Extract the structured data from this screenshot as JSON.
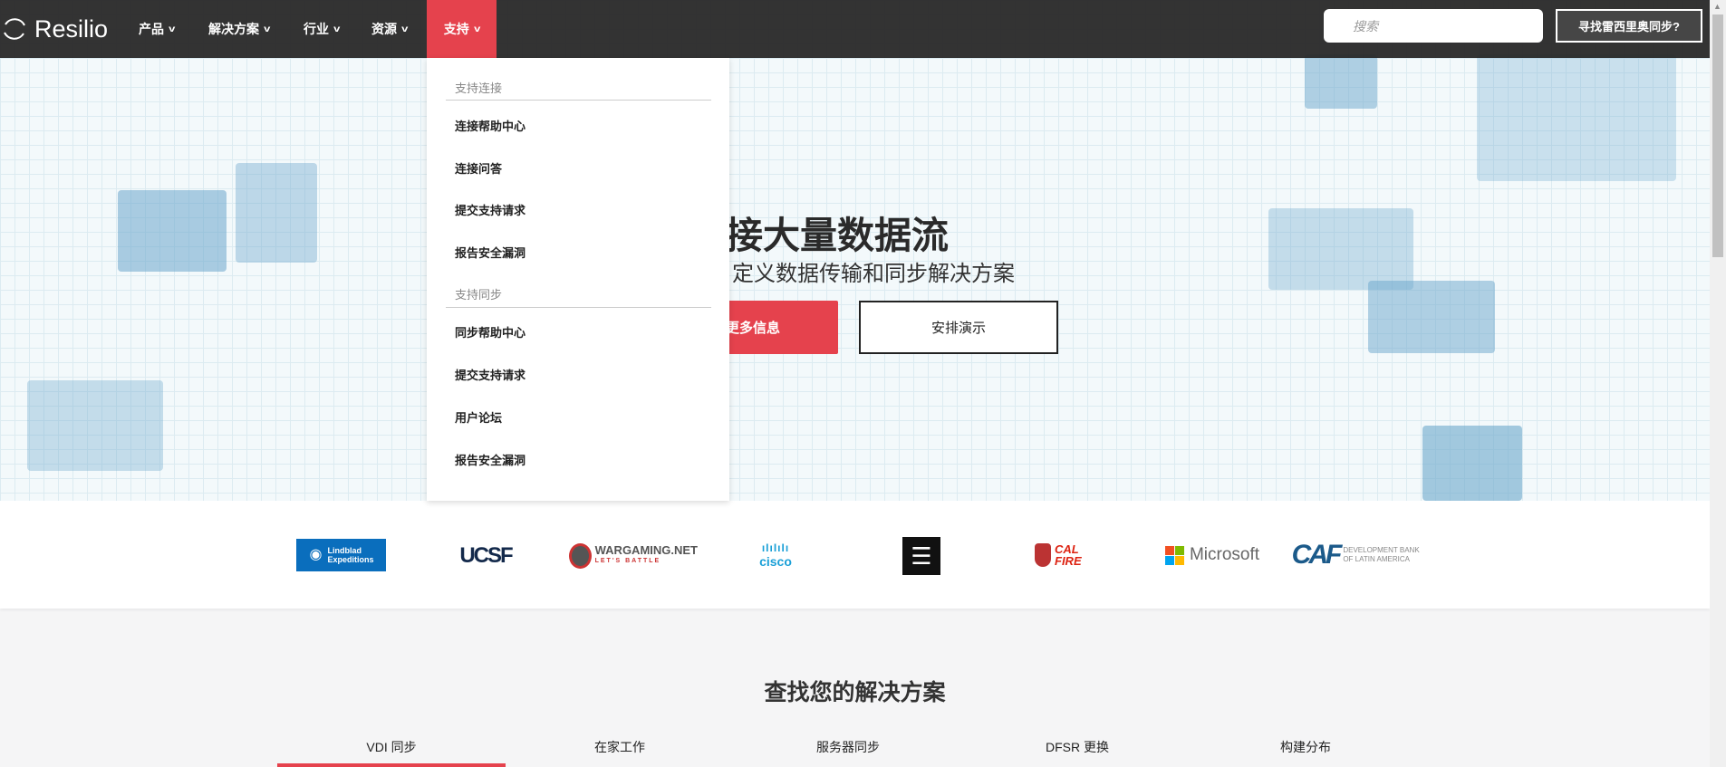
{
  "nav": {
    "brand": "Resilio",
    "items": [
      {
        "label": "产品"
      },
      {
        "label": "解决方案"
      },
      {
        "label": "行业"
      },
      {
        "label": "资源"
      },
      {
        "label": "支持"
      }
    ],
    "search_placeholder": "搜索",
    "find_button": "寻找雷西里奥同步?"
  },
  "dropdown": {
    "sections": [
      {
        "header": "支持连接",
        "items": [
          "连接帮助中心",
          "连接问答",
          "提交支持请求",
          "报告安全漏洞"
        ]
      },
      {
        "header": "支持同步",
        "items": [
          "同步帮助中心",
          "提交支持请求",
          "用户论坛",
          "报告安全漏洞"
        ]
      }
    ]
  },
  "hero": {
    "headline": "连接大量数据流",
    "subtitle": "和自定义数据传输和同步解决方案",
    "primary_button": "更多信息",
    "secondary_button": "安排演示"
  },
  "logos": [
    "Lindblad Expeditions",
    "UCSF",
    "WARGAMING.NET",
    "LET'S BATTLE",
    "cisco",
    "CAL FIRE",
    "Microsoft",
    "CAF",
    "DEVELOPMENT BANK OF LATIN AMERICA"
  ],
  "solutions": {
    "title": "查找您的解决方案",
    "tabs": [
      "VDI 同步",
      "在家工作",
      "服务器同步",
      "DFSR 更换",
      "构建分布"
    ],
    "active_tab": 0
  },
  "colors": {
    "accent": "#e5424d",
    "nav_bg": "#2b2b2b"
  }
}
